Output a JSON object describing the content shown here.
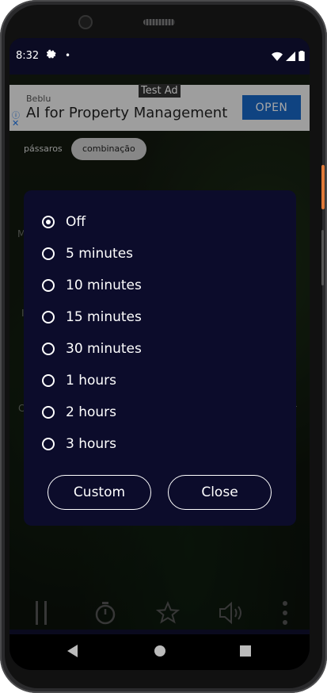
{
  "status_bar": {
    "time": "8:32",
    "gear_icon": "gear-icon",
    "dot": "•"
  },
  "ad": {
    "tag": "Test Ad",
    "brand": "Beblu",
    "title": "AI for Property Management",
    "button_label": "OPEN",
    "info_icon": "ⓘ",
    "close_icon": "✕"
  },
  "chips": [
    {
      "label": "pássaros",
      "selected": false
    },
    {
      "label": "combinação",
      "selected": true
    }
  ],
  "background_fragments": {
    "left_m": "M",
    "left_i": "I",
    "left_c": "C",
    "right_r": "r"
  },
  "timer_dialog": {
    "options": [
      {
        "label": "Off",
        "selected": true
      },
      {
        "label": "5 minutes",
        "selected": false
      },
      {
        "label": "10 minutes",
        "selected": false
      },
      {
        "label": "15 minutes",
        "selected": false
      },
      {
        "label": "30 minutes",
        "selected": false
      },
      {
        "label": "1 hours",
        "selected": false
      },
      {
        "label": "2 hours",
        "selected": false
      },
      {
        "label": "3 hours",
        "selected": false
      }
    ],
    "custom_label": "Custom",
    "close_label": "Close"
  },
  "toolbar_icons": [
    "pause-icon",
    "timer-icon",
    "star-icon",
    "volume-icon",
    "more-vertical-icon"
  ],
  "nav_icons": [
    "back-icon",
    "home-icon",
    "recents-icon"
  ]
}
